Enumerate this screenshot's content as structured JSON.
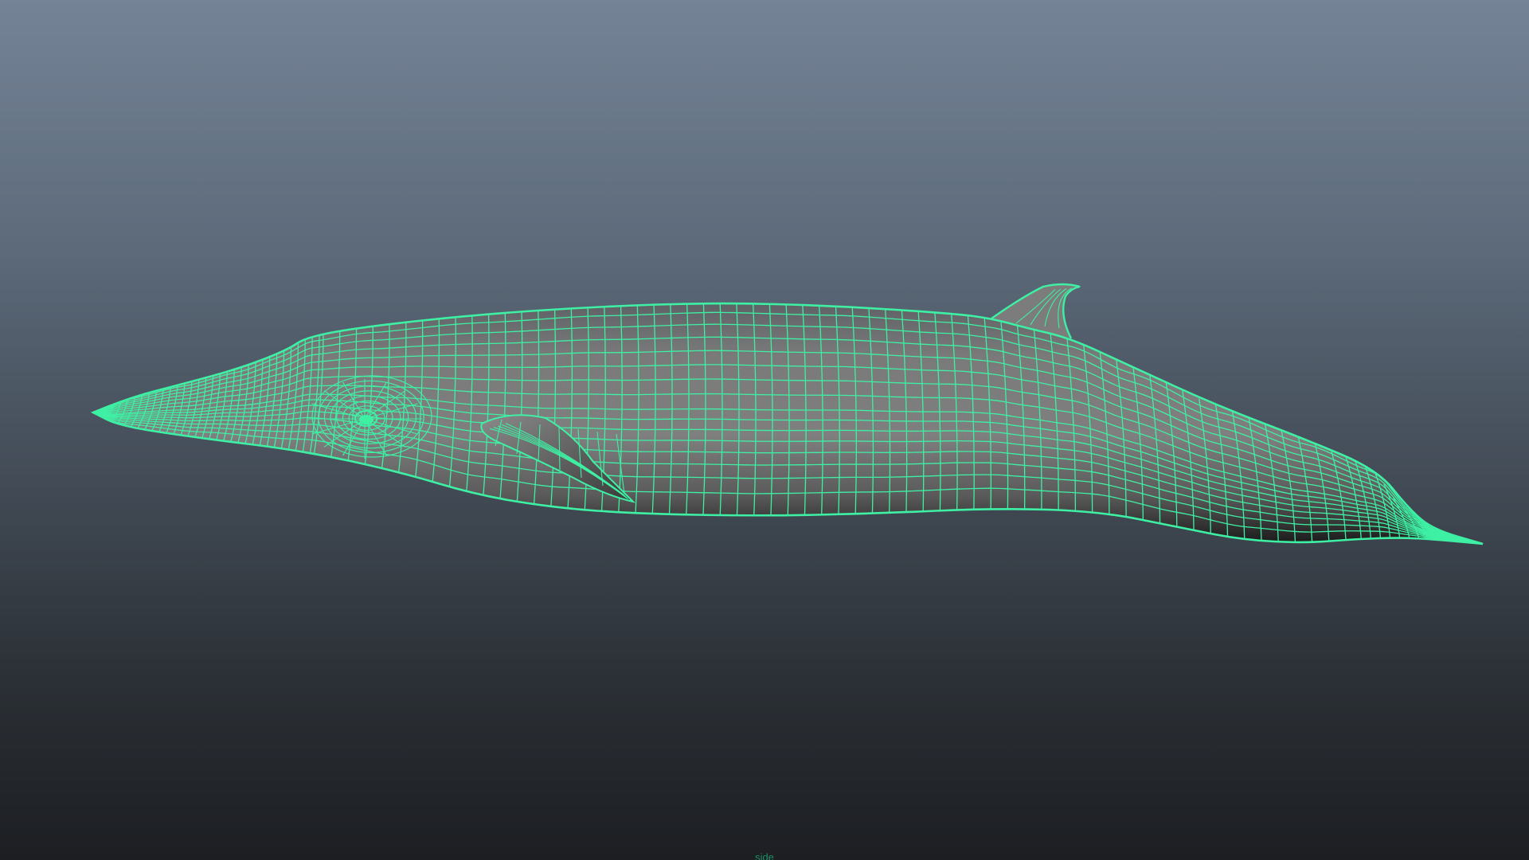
{
  "viewport": {
    "camera_label": "side",
    "background_top": "#748396",
    "background_bottom": "#1c1e22"
  },
  "mesh": {
    "object": "whale",
    "display": "wireframe-on-shaded",
    "wire_color": "#3ef0a4",
    "shade_color": "#7b7b7b"
  }
}
